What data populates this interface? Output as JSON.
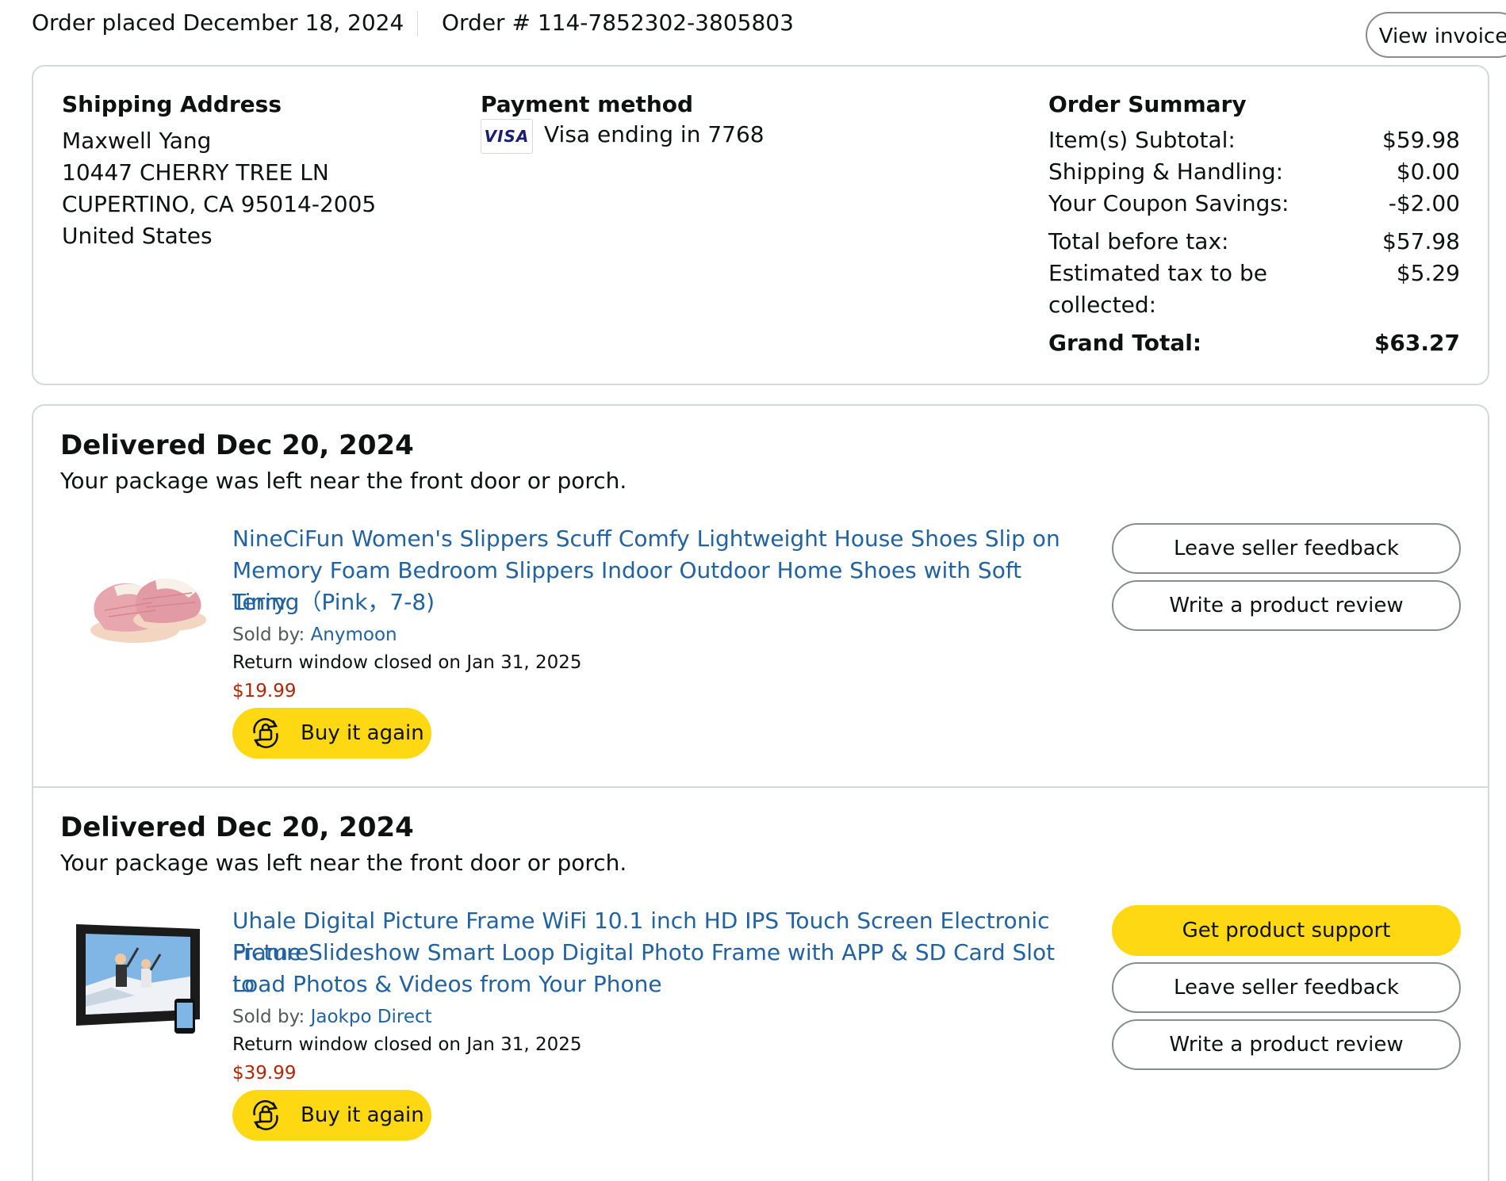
{
  "header": {
    "order_placed": "Order placed December 18, 2024",
    "order_number": "Order # 114-7852302-3805803",
    "view_invoice": "View invoice"
  },
  "shipping_address": {
    "heading": "Shipping Address",
    "name": "Maxwell Yang",
    "street": "10447 CHERRY TREE LN",
    "city_state_zip": "CUPERTINO, CA 95014-2005",
    "country": "United States"
  },
  "payment": {
    "heading": "Payment method",
    "card_brand": "VISA",
    "card_text": "Visa  ending in 7768"
  },
  "summary": {
    "heading": "Order Summary",
    "subtotal_label": "Item(s) Subtotal:",
    "subtotal_value": "$59.98",
    "shipping_label": "Shipping & Handling:",
    "shipping_value": "$0.00",
    "coupon_label": "Your Coupon Savings:",
    "coupon_value": "-$2.00",
    "before_tax_label": "Total before tax:",
    "before_tax_value": "$57.98",
    "tax_label_1": "Estimated tax to be",
    "tax_label_2": "collected:",
    "tax_value": "$5.29",
    "grand_label": "Grand Total:",
    "grand_value": "$63.27"
  },
  "shipments": [
    {
      "status": "Delivered Dec 20, 2024",
      "note": "Your package was left near the front door or porch.",
      "product_title_1": "NineCiFun Women's Slippers Scuff Comfy Lightweight House Shoes Slip on",
      "product_title_2": "Memory Foam Bedroom Slippers Indoor Outdoor Home Shoes with Soft Terry",
      "product_title_3": "Lining（Pink，7-8)",
      "sold_by_label": "Sold by: ",
      "seller": "Anymoon",
      "return_window": "Return window closed on Jan 31, 2025",
      "price": "$19.99",
      "buy_again": "Buy it again",
      "actions": [
        "Leave seller feedback",
        "Write a product review"
      ]
    },
    {
      "status": "Delivered Dec 20, 2024",
      "note": "Your package was left near the front door or porch.",
      "product_title_1": "Uhale Digital Picture Frame WiFi 10.1 inch HD IPS Touch Screen Electronic Picture",
      "product_title_2": "Frame Slideshow Smart Loop Digital Photo Frame with APP & SD Card Slot to",
      "product_title_3": "Load Photos & Videos from Your Phone",
      "sold_by_label": "Sold by: ",
      "seller": "Jaokpo Direct",
      "return_window": "Return window closed on Jan 31, 2025",
      "price": "$39.99",
      "buy_again": "Buy it again",
      "actions": [
        "Get product support",
        "Leave seller feedback",
        "Write a product review"
      ]
    }
  ],
  "colors": {
    "link": "#2162a1",
    "price": "#b12704",
    "button_yellow": "#ffd814",
    "border": "#d5d9d9"
  }
}
